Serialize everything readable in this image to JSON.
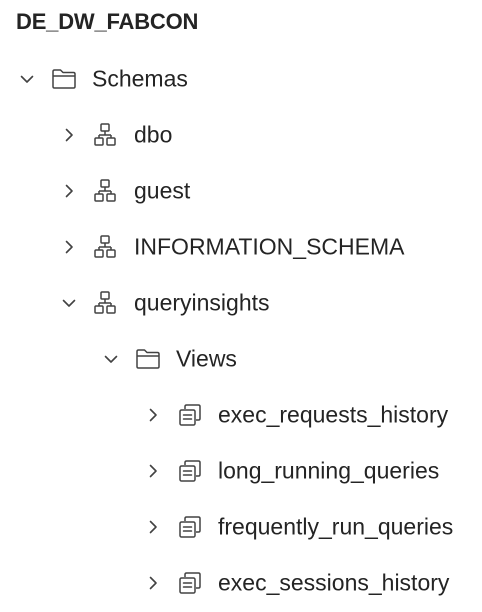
{
  "database": {
    "name": "DE_DW_FABCON"
  },
  "tree": {
    "schemas_folder": {
      "label": "Schemas",
      "state": "expanded",
      "icon": "folder-icon"
    },
    "schemas": [
      {
        "label": "dbo",
        "state": "collapsed",
        "icon": "schema-icon"
      },
      {
        "label": "guest",
        "state": "collapsed",
        "icon": "schema-icon"
      },
      {
        "label": "INFORMATION_SCHEMA",
        "state": "collapsed",
        "icon": "schema-icon"
      },
      {
        "label": "queryinsights",
        "state": "expanded",
        "icon": "schema-icon"
      }
    ],
    "views_folder": {
      "label": "Views",
      "state": "expanded",
      "icon": "folder-icon"
    },
    "views": [
      {
        "label": "exec_requests_history",
        "state": "collapsed",
        "icon": "view-icon"
      },
      {
        "label": "long_running_queries",
        "state": "collapsed",
        "icon": "view-icon"
      },
      {
        "label": "frequently_run_queries",
        "state": "collapsed",
        "icon": "view-icon"
      },
      {
        "label": "exec_sessions_history",
        "state": "collapsed",
        "icon": "view-icon"
      }
    ]
  },
  "colors": {
    "text": "#242424",
    "icon": "#424242"
  }
}
